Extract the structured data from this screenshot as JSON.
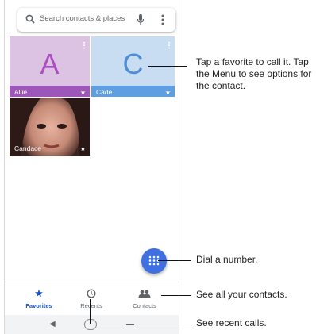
{
  "search": {
    "placeholder": "Search contacts & places"
  },
  "favorites": [
    {
      "name": "Allie",
      "letter": "A",
      "bg": "#dcc3e3",
      "letter_color": "#a94fbf",
      "bar": "#9d57b8"
    },
    {
      "name": "Cade",
      "letter": "C",
      "bg": "#c8ddf2",
      "letter_color": "#4e8ed6",
      "bar": "#5f9ee0"
    },
    {
      "name": "Candace",
      "letter": "",
      "bg": "#6b4a44",
      "letter_color": "#ffffff",
      "bar": "transparent"
    }
  ],
  "nav": {
    "favorites": "Favorites",
    "recents": "Recents",
    "contacts": "Contacts"
  },
  "callouts": {
    "favorite": "Tap a favorite to call it. Tap the Menu to see options for the contact.",
    "dial": "Dial a number.",
    "contacts": "See all your contacts.",
    "recent": "See recent calls."
  },
  "colors": {
    "accent": "#3f6fe0",
    "nav_active": "#1a53c5"
  }
}
